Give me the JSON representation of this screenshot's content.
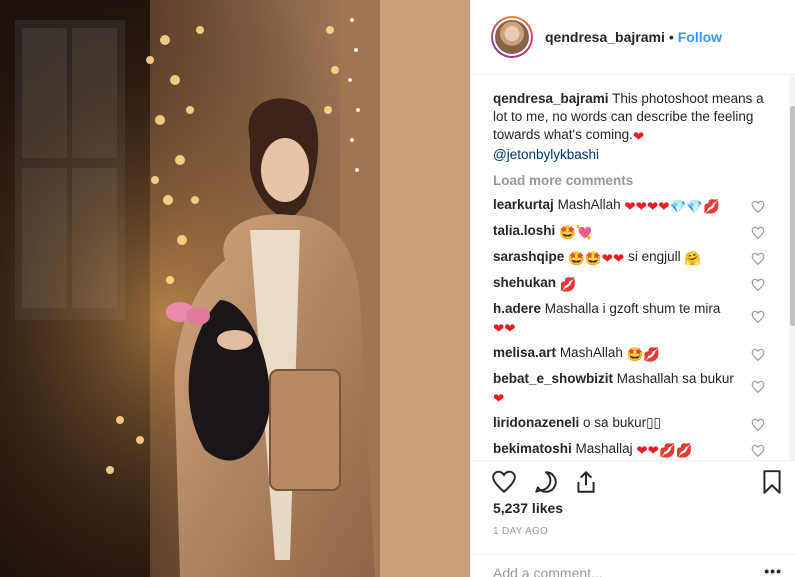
{
  "post": {
    "username": "qendresa_bajrami",
    "separator": "•",
    "follow_label": "Follow",
    "caption_text": "This photoshoot means a lot to me, no words can describe the feeling towards what's coming.",
    "caption_mention": "@jetonbylykbashi",
    "load_more_label": "Load more comments",
    "likes": "5,237 likes",
    "timestamp": "1 DAY AGO",
    "add_comment_placeholder": "Add a comment...",
    "more_label": "•••"
  },
  "comments": [
    {
      "user": "learkurtaj",
      "text": "MashAllah",
      "emoji": "❤❤❤❤💎💎💋"
    },
    {
      "user": "talia.loshi",
      "text": "",
      "emoji": "🤩💘"
    },
    {
      "user": "sarashqipe",
      "text": "si engjull",
      "emoji_before": "🤩🤩❤❤",
      "emoji": "🤗"
    },
    {
      "user": "shehukan",
      "text": "",
      "emoji": "💋"
    },
    {
      "user": "h.adere",
      "text": "Mashalla i gzoft shum te mira",
      "emoji": "❤❤"
    },
    {
      "user": "melisa.art",
      "text": "MashAllah",
      "emoji": "🤩💋"
    },
    {
      "user": "bebat_e_showbizit",
      "text": "Mashallah sa bukur",
      "emoji": "❤"
    },
    {
      "user": "liridonazeneli",
      "text": "o sa bukur▯▯",
      "emoji": ""
    },
    {
      "user": "bekimatoshi",
      "text": "Mashallaj",
      "emoji": "❤❤💋💋"
    }
  ],
  "icons": {
    "like": "heart-icon",
    "comment": "comment-icon",
    "share": "share-icon",
    "save": "bookmark-icon"
  },
  "colors": {
    "link": "#3897f0",
    "mention": "#003569",
    "muted": "#999999",
    "heart": "#ed1c24"
  }
}
